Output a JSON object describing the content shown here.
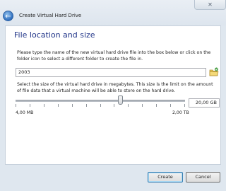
{
  "window": {
    "title": "Create Virtual Hard Drive",
    "close_glyph": "✕"
  },
  "panel": {
    "heading": "File location and size",
    "location_instructions": "Please type the name of the new virtual hard drive file into the box below or click on the folder icon to select a different folder to create the file in.",
    "file_name_value": "2003",
    "size_instructions": "Select the size of the virtual hard drive in megabytes. This size is the limit on the amount of file data that a virtual machine will be able to store on the hard drive.",
    "size_value": "20,00 GB",
    "slider_level_percent": 62,
    "min_label": "4,00 MB",
    "max_label": "2,00 TB"
  },
  "buttons": {
    "create_label": "Create",
    "cancel_label": "Cancel"
  },
  "icons": {
    "back": "back-arrow-icon",
    "folder": "folder-icon",
    "close": "close-icon"
  }
}
